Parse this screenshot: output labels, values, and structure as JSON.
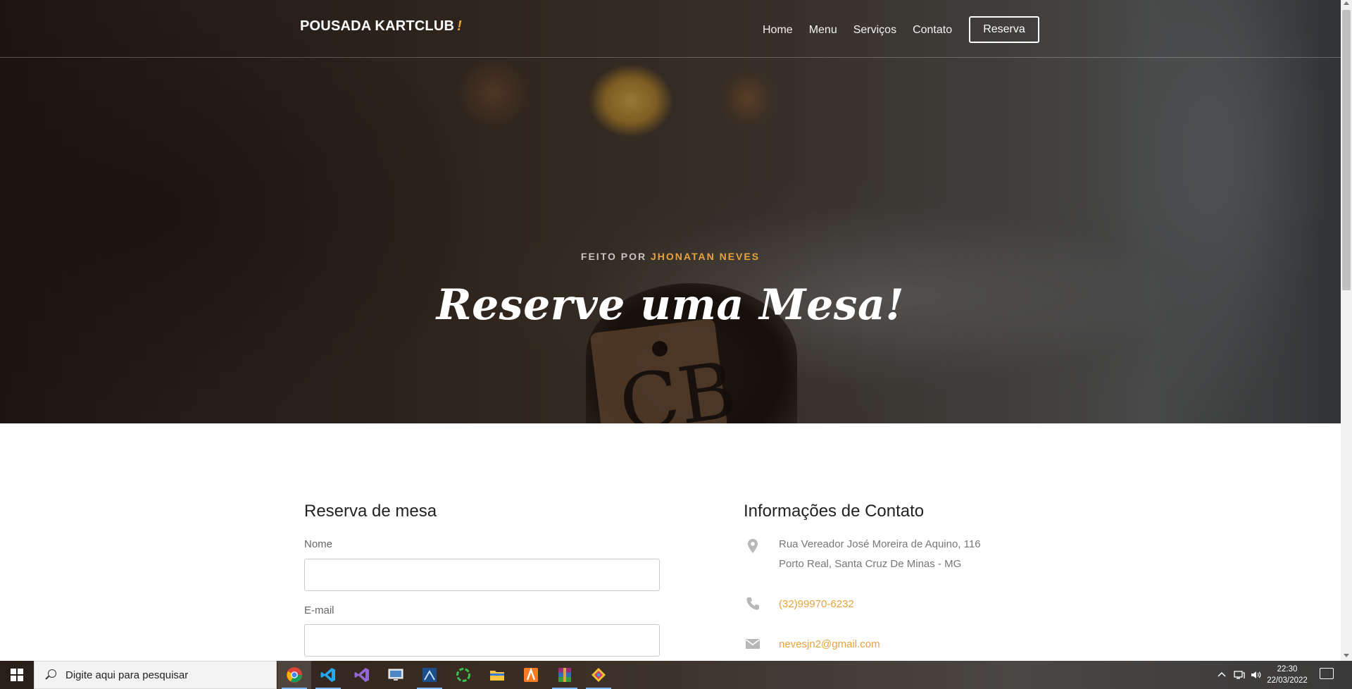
{
  "header": {
    "brand": "POUSADA KARTCLUB",
    "brand_accent": "!",
    "nav": [
      "Home",
      "Menu",
      "Serviços",
      "Contato"
    ],
    "cta": "Reserva"
  },
  "hero": {
    "kicker_prefix": "FEITO POR",
    "kicker_author": "JHONATAN NEVES",
    "title": "Reserve uma Mesa!",
    "tag_letters": "CB"
  },
  "reservation": {
    "title": "Reserva de mesa",
    "fields": [
      {
        "label": "Nome",
        "value": ""
      },
      {
        "label": "E-mail",
        "value": ""
      }
    ]
  },
  "contact": {
    "title": "Informações de Contato",
    "address_line1": "Rua Vereador José Moreira de Aquino, 116",
    "address_line2": "Porto Real, Santa Cruz De Minas - MG",
    "phone": "(32)99970-6232",
    "email": "nevesjn2@gmail.com",
    "icons": [
      "map-pin-icon",
      "phone-icon",
      "envelope-icon"
    ]
  },
  "taskbar": {
    "search_placeholder": "Digite aqui para pesquisar",
    "apps": [
      "chrome",
      "vscode",
      "visual-studio",
      "remote-desktop",
      "sql-server-management",
      "circular-sync",
      "file-explorer",
      "xampp",
      "winrar",
      "git-kraken"
    ],
    "time": "22:30",
    "date": "22/03/2022"
  },
  "colors": {
    "accent": "#e8a33a",
    "text_dark": "#222222",
    "text_muted": "#777777"
  }
}
